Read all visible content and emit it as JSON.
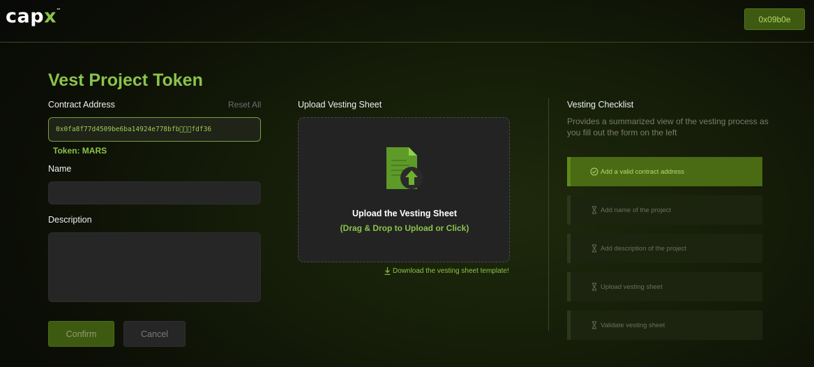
{
  "header": {
    "logo_main": "cap",
    "logo_accent": "x",
    "logo_tm": "™",
    "wallet_address": "0x09b0e"
  },
  "form": {
    "title": "Vest Project Token",
    "contract_label": "Contract Address",
    "reset_label": "Reset All",
    "contract_value": "0x0fa8f77d4509be6ba14924e778bfb⃥⃥⃥fdf36",
    "token_label": "Token: MARS",
    "name_label": "Name",
    "name_value": "",
    "description_label": "Description",
    "description_value": "",
    "confirm_label": "Confirm",
    "cancel_label": "Cancel"
  },
  "upload": {
    "section_label": "Upload Vesting Sheet",
    "title": "Upload the Vesting Sheet",
    "subtitle": "(Drag & Drop to Upload or Click)",
    "download_link": "Download the vesting sheet template!",
    "icon": "document-upload-icon"
  },
  "checklist": {
    "title": "Vesting Checklist",
    "description": "Provides a summarized view of the vesting process as you fill out the form on the left",
    "items": [
      {
        "label": "Add a valid contract address",
        "status": "done",
        "icon": "check-circle-icon"
      },
      {
        "label": "Add name of the project",
        "status": "pending",
        "icon": "hourglass-icon"
      },
      {
        "label": "Add description of the project",
        "status": "pending",
        "icon": "hourglass-icon"
      },
      {
        "label": "Upload vesting sheet",
        "status": "pending",
        "icon": "hourglass-icon"
      },
      {
        "label": "Validate vesting sheet",
        "status": "pending",
        "icon": "hourglass-icon"
      }
    ]
  },
  "colors": {
    "accent": "#8bc34a",
    "button_green": "#3d5a10",
    "active_item": "#4b6a14"
  }
}
